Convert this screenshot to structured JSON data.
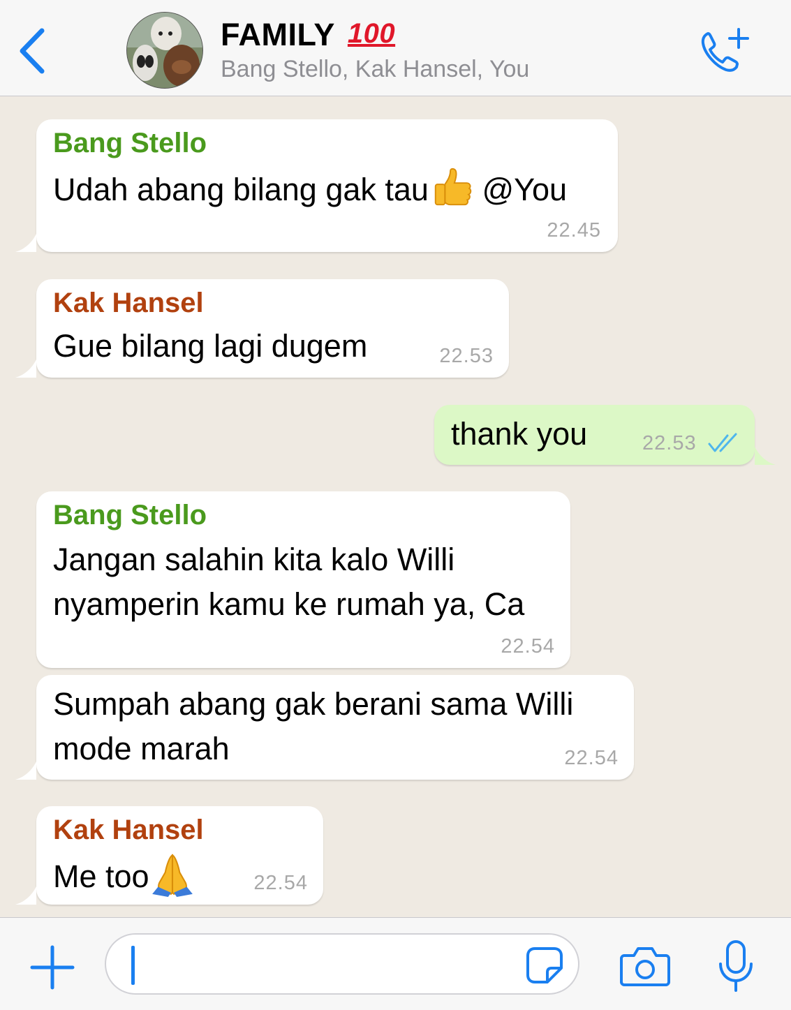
{
  "header": {
    "title": "FAMILY",
    "title_emoji": "100",
    "members": "Bang Stello, Kak Hansel, You",
    "accent_color": "#1a7ff0"
  },
  "messages": [
    {
      "sender": "Bang Stello",
      "sender_color": "#4a9a1d",
      "text": "Udah abang bilang gak tau",
      "text_after_emoji": " @You",
      "emoji": "thumbs-up",
      "time": "22.45",
      "direction": "incoming"
    },
    {
      "sender": "Kak Hansel",
      "sender_color": "#b1410f",
      "text": "Gue bilang lagi dugem",
      "time": "22.53",
      "direction": "incoming"
    },
    {
      "text": "thank you",
      "time": "22.53",
      "direction": "outgoing",
      "status": "read"
    },
    {
      "sender": "Bang Stello",
      "sender_color": "#4a9a1d",
      "lines": [
        "Jangan salahin kita kalo Willi",
        "nyamperin kamu ke rumah ya, Ca"
      ],
      "time": "22.54",
      "direction": "incoming"
    },
    {
      "lines": [
        "Sumpah abang gak berani sama Willi",
        "mode marah"
      ],
      "time": "22.54",
      "direction": "incoming"
    },
    {
      "sender": "Kak Hansel",
      "sender_color": "#b1410f",
      "text": "Me too",
      "emoji": "folded-hands",
      "time": "22.54",
      "direction": "incoming"
    }
  ],
  "input": {
    "value": "",
    "placeholder": ""
  }
}
